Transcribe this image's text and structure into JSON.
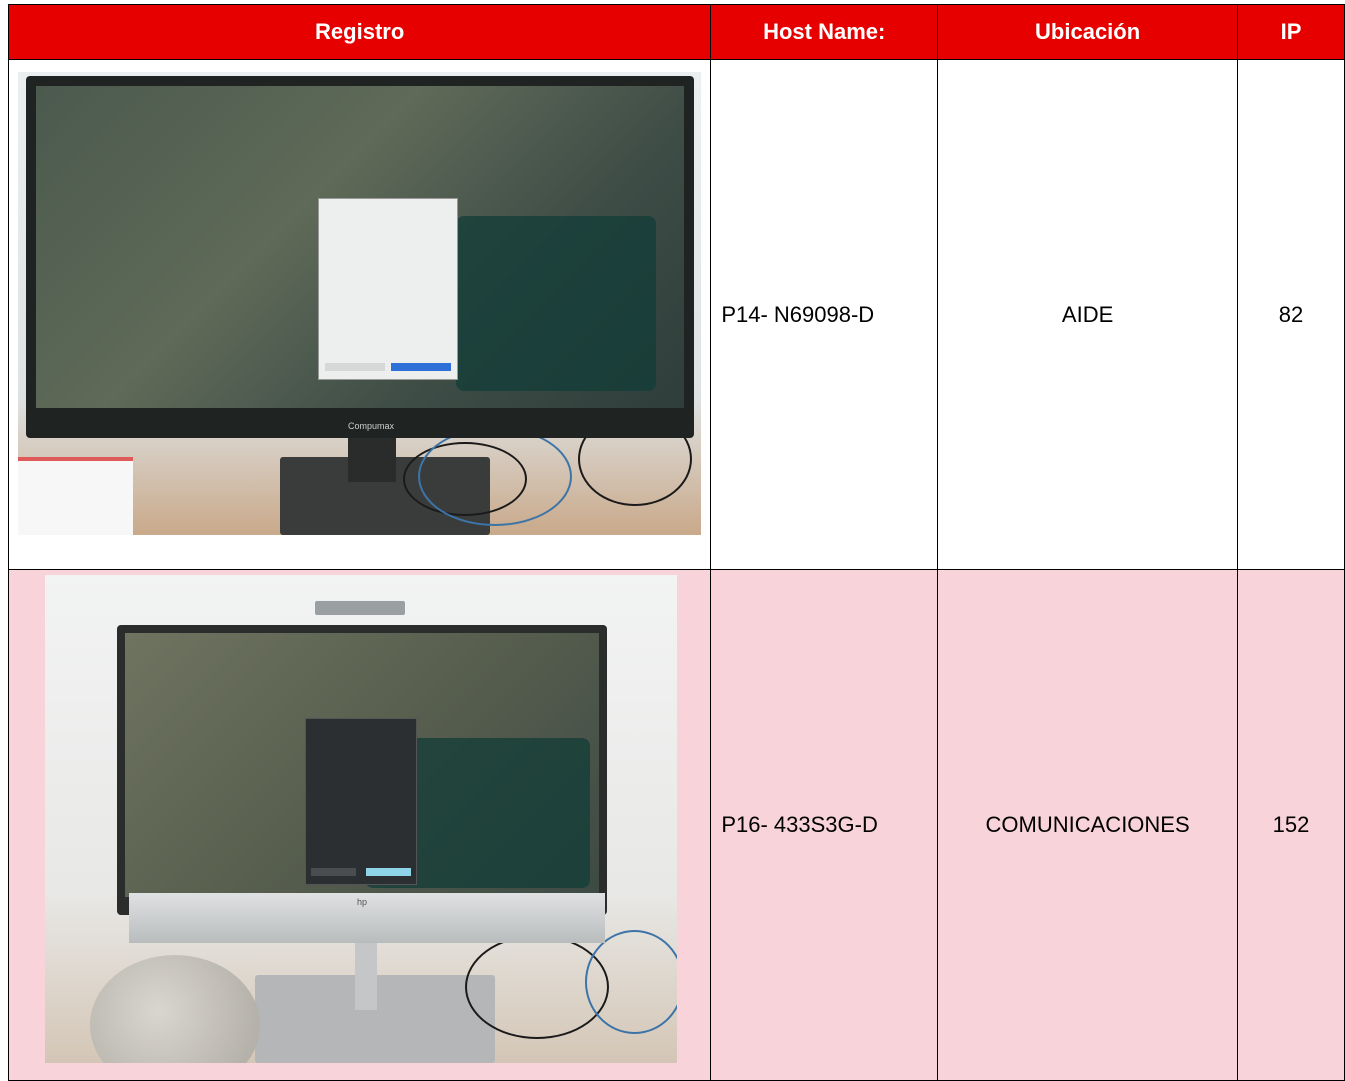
{
  "headers": {
    "registro": "Registro",
    "host_name": "Host Name:",
    "ubicacion": "Ubicación",
    "ip": "IP"
  },
  "rows": [
    {
      "host": "P14- N69098-D",
      "ubicacion": "AIDE",
      "ip": "82",
      "photo": {
        "monitor_brand": "Compumax"
      }
    },
    {
      "host": "P16- 433S3G-D",
      "ubicacion": "COMUNICACIONES",
      "ip": "152",
      "photo": {
        "monitor_brand": "hp"
      }
    }
  ],
  "colors": {
    "header_bg": "#e60000",
    "header_text": "#ffffff",
    "row2_bg": "#f8d3da"
  }
}
